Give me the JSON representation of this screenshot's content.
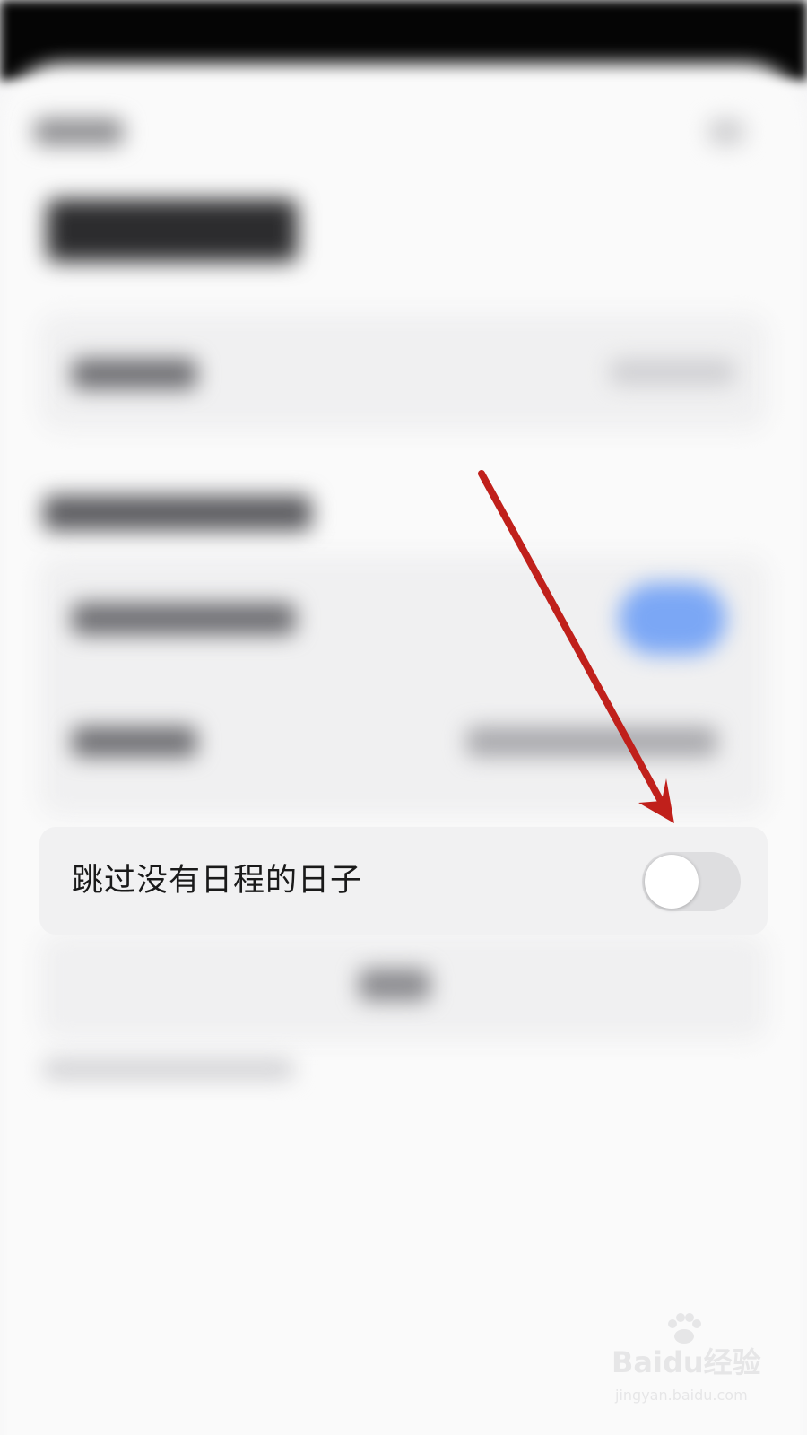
{
  "setting_row": {
    "label": "跳过没有日程的日子",
    "toggle_on": false
  },
  "colors": {
    "annotation_arrow": "#c0201b",
    "toggle_track_off": "#dedee0",
    "highlight_toggle_blurred": "#7ba7f5"
  },
  "watermark": {
    "logo": "Baidu经验",
    "url": "jingyan.baidu.com"
  }
}
